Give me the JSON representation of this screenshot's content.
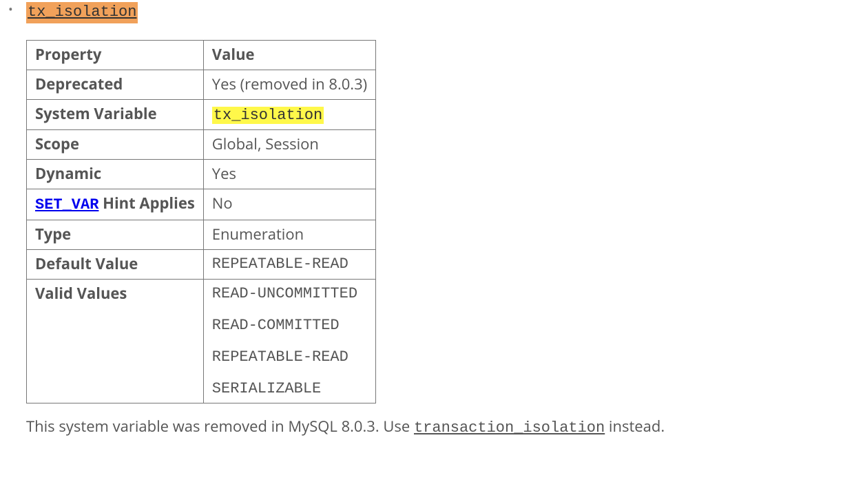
{
  "heading": "tx_isolation",
  "table": {
    "header_property": "Property",
    "header_value": "Value",
    "rows": {
      "deprecated": {
        "label": "Deprecated",
        "value": "Yes (removed in 8.0.3)"
      },
      "system_variable": {
        "label": "System Variable",
        "value": "tx_isolation"
      },
      "scope": {
        "label": "Scope",
        "value": "Global, Session"
      },
      "dynamic": {
        "label": "Dynamic",
        "value": "Yes"
      },
      "set_var": {
        "label_code": "SET_VAR",
        "label_rest": " Hint Applies",
        "value": "No"
      },
      "type": {
        "label": "Type",
        "value": "Enumeration"
      },
      "default_value": {
        "label": "Default Value",
        "value": "REPEATABLE-READ"
      },
      "valid_values": {
        "label": "Valid Values",
        "v0": "READ-UNCOMMITTED",
        "v1": "READ-COMMITTED",
        "v2": "REPEATABLE-READ",
        "v3": "SERIALIZABLE"
      }
    }
  },
  "note": {
    "pre": "This system variable was removed in MySQL 8.0.3. Use ",
    "link": "transaction_isolation",
    "post": " instead."
  }
}
